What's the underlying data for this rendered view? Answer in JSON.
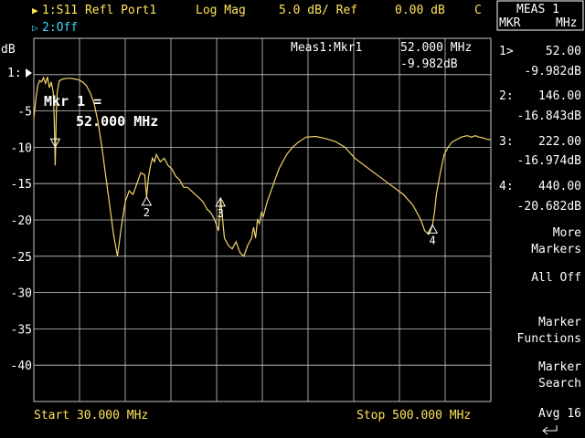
{
  "header": {
    "trace1_marker": "▶",
    "trace1_label": "1:S11 Refl Port1",
    "format": "Log Mag",
    "scale": "5.0 dB/ Ref",
    "ref_value": "0.00 dB",
    "channel": "C",
    "trace2_marker": "▷",
    "trace2_label": "2:Off"
  },
  "colors": {
    "trace1": "#ffe35a",
    "trace2": "#3fd6ff",
    "trace": "#f4d56a",
    "grid": "#c8c8c8",
    "text": "#ffffff",
    "footer": "#ffe35a"
  },
  "plot": {
    "unit_label": "dB",
    "ref_label": "1:",
    "meas_label": "Meas1:Mkr1",
    "meas_freq": "52.000 MHz",
    "meas_value": "-9.982dB",
    "active_marker_line1": "Mkr 1 =",
    "active_marker_line2": "52.000 MHz"
  },
  "footer": {
    "start": "Start 30.000 MHz",
    "stop": "Stop 500.000 MHz"
  },
  "side_panel": {
    "title_line1": "MEAS 1",
    "title_line2_left": "MKR",
    "title_line2_right": "MHz",
    "markers": [
      {
        "label": "1>",
        "freq": "52.00",
        "value": "-9.982dB"
      },
      {
        "label": "2:",
        "freq": "146.00",
        "value": "-16.843dB"
      },
      {
        "label": "3:",
        "freq": "222.00",
        "value": "-16.974dB"
      },
      {
        "label": "4:",
        "freq": "440.00",
        "value": "-20.682dB"
      }
    ],
    "softkeys": [
      {
        "line1": "More",
        "line2": "Markers"
      },
      {
        "line1": "All Off",
        "line2": ""
      },
      {
        "line1": "Marker",
        "line2": "Functions"
      },
      {
        "line1": "Marker",
        "line2": "Search"
      },
      {
        "line1": "Avg 16",
        "line2": ""
      }
    ],
    "return_icon": "return-arrow-icon"
  },
  "chart_data": {
    "type": "line",
    "title": "",
    "xlabel": "",
    "ylabel": "dB",
    "xlim": [
      30,
      500
    ],
    "ylim": [
      -45,
      5
    ],
    "yticks": [
      -5,
      -10,
      -15,
      -20,
      -25,
      -30,
      -35,
      -40
    ],
    "ytick_labels": [
      "-5",
      "-10",
      "-15",
      "-20",
      "-25",
      "-30",
      "-35",
      "-40"
    ],
    "grid": true,
    "series": [
      {
        "x": [
          30,
          32,
          34,
          36,
          38,
          40,
          42,
          44,
          46,
          48,
          50,
          51,
          52,
          53,
          54,
          56,
          58,
          60,
          64,
          68,
          72,
          76,
          80,
          84,
          88,
          92,
          96,
          100,
          104,
          108,
          112,
          116,
          120,
          124,
          128,
          132,
          136,
          140,
          144,
          146,
          148,
          150,
          152,
          154,
          156,
          160,
          164,
          168,
          172,
          176,
          180,
          184,
          188,
          192,
          196,
          200,
          204,
          208,
          212,
          216,
          220,
          222,
          226,
          230,
          234,
          238,
          242,
          246,
          250,
          254,
          256,
          258,
          260,
          262,
          264,
          266,
          270,
          274,
          278,
          282,
          286,
          290,
          296,
          302,
          310,
          320,
          330,
          340,
          350,
          360,
          370,
          380,
          390,
          400,
          410,
          420,
          428,
          432,
          436,
          438,
          440,
          442,
          444,
          448,
          452,
          456,
          460,
          464,
          468,
          472,
          476,
          480,
          484,
          488,
          492,
          496,
          500
        ],
        "y": [
          -6.0,
          -3.5,
          -1.5,
          -0.8,
          -1.0,
          -0.4,
          -1.2,
          -0.3,
          -1.8,
          -1.0,
          -2.5,
          -6.0,
          -12.5,
          -6.0,
          -2.5,
          -0.9,
          -0.7,
          -0.6,
          -0.5,
          -0.5,
          -0.6,
          -0.7,
          -1.0,
          -1.5,
          -2.5,
          -4.0,
          -6.5,
          -10.0,
          -14.0,
          -18.0,
          -22.0,
          -25.0,
          -21.0,
          -17.5,
          -16.0,
          -16.5,
          -15.0,
          -13.5,
          -13.8,
          -16.84,
          -14.0,
          -12.5,
          -11.5,
          -12.0,
          -11.0,
          -12.0,
          -11.5,
          -12.5,
          -13.0,
          -14.0,
          -14.5,
          -15.5,
          -15.5,
          -16.0,
          -16.5,
          -17.0,
          -17.5,
          -18.5,
          -19.0,
          -20.0,
          -21.5,
          -16.97,
          -22.5,
          -23.5,
          -24.0,
          -23.0,
          -24.5,
          -25.0,
          -23.5,
          -22.5,
          -21.0,
          -22.5,
          -20.0,
          -20.5,
          -19.0,
          -19.5,
          -17.5,
          -16.0,
          -14.5,
          -13.0,
          -12.0,
          -11.0,
          -10.0,
          -9.3,
          -8.6,
          -8.5,
          -8.8,
          -9.2,
          -10.0,
          -11.5,
          -12.5,
          -13.5,
          -14.5,
          -15.5,
          -16.5,
          -18.0,
          -20.0,
          -21.5,
          -22.0,
          -21.5,
          -20.68,
          -19.0,
          -16.5,
          -13.5,
          -11.0,
          -10.0,
          -9.3,
          -9.0,
          -8.7,
          -8.5,
          -8.4,
          -8.6,
          -8.4,
          -8.6,
          -8.7,
          -8.9,
          -9.0
        ]
      }
    ],
    "markers": [
      {
        "id": "1",
        "x": 52,
        "y": -9.982,
        "label": "1",
        "active": true
      },
      {
        "id": "2",
        "x": 146,
        "y": -16.843,
        "label": "2",
        "active": false
      },
      {
        "id": "3",
        "x": 222,
        "y": -16.974,
        "label": "3",
        "active": false
      },
      {
        "id": "4",
        "x": 440,
        "y": -20.682,
        "label": "4",
        "active": false
      }
    ]
  }
}
